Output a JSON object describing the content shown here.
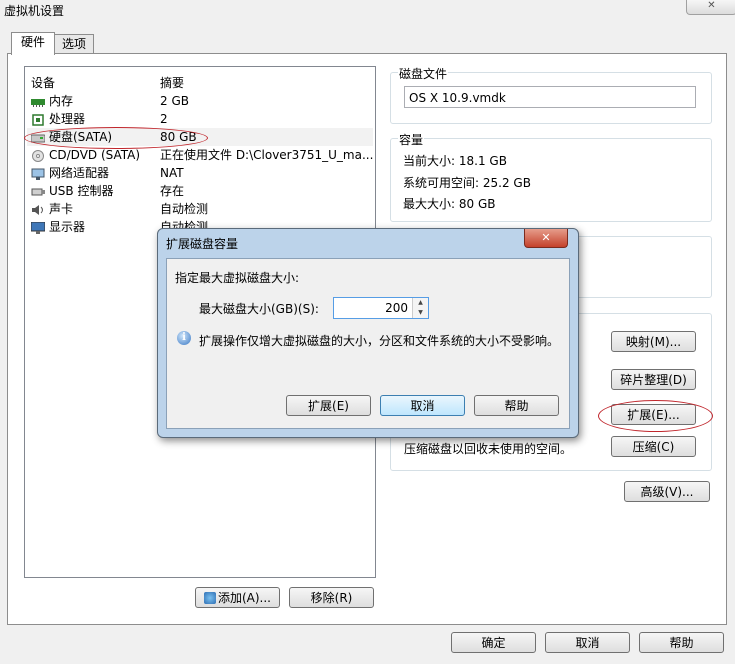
{
  "window": {
    "title": "虚拟机设置",
    "close_glyph": "✕"
  },
  "tabs": [
    {
      "label": "硬件"
    },
    {
      "label": "选项"
    }
  ],
  "device_list": {
    "headers": {
      "device": "设备",
      "summary": "摘要"
    },
    "rows": [
      {
        "name": "内存",
        "summary": "2 GB",
        "icon": "memory-icon"
      },
      {
        "name": "处理器",
        "summary": "2",
        "icon": "cpu-icon"
      },
      {
        "name": "硬盘(SATA)",
        "summary": "80 GB",
        "icon": "hard-disk-icon"
      },
      {
        "name": "CD/DVD (SATA)",
        "summary": "正在使用文件 D:\\Clover3751_U_ma...",
        "icon": "cd-dvd-icon"
      },
      {
        "name": "网络适配器",
        "summary": "NAT",
        "icon": "network-adapter-icon"
      },
      {
        "name": "USB 控制器",
        "summary": "存在",
        "icon": "usb-icon"
      },
      {
        "name": "声卡",
        "summary": "自动检测",
        "icon": "sound-card-icon"
      },
      {
        "name": "显示器",
        "summary": "自动检测",
        "icon": "display-icon"
      }
    ],
    "add_label": "添加(A)...",
    "remove_label": "移除(R)"
  },
  "disk_file": {
    "title": "磁盘文件",
    "value": "OS X 10.9.vmdk"
  },
  "capacity": {
    "title": "容量",
    "current_size": "当前大小: 18.1 GB",
    "system_free": "系统可用空间: 25.2 GB",
    "max_size": "最大大小: 80 GB"
  },
  "utilities": {
    "map_label": "映射(M)...",
    "defrag_label": "碎片整理(D)",
    "expand_label": "扩展(E)...",
    "compact_desc": "压缩磁盘以回收未使用的空间。",
    "compact_label": "压缩(C)",
    "advanced_label": "高级(V)..."
  },
  "footer": {
    "ok_label": "确定",
    "cancel_label": "取消",
    "help_label": "帮助"
  },
  "expand_dialog": {
    "title": "扩展磁盘容量",
    "close_glyph": "✕",
    "prompt": "指定最大虚拟磁盘大小:",
    "size_label": "最大磁盘大小(GB)(S):",
    "size_value": "200",
    "info_text": "扩展操作仅增大虚拟磁盘的大小，分区和文件系统的大小不受影响。",
    "expand_label": "扩展(E)",
    "cancel_label": "取消",
    "help_label": "帮助"
  }
}
